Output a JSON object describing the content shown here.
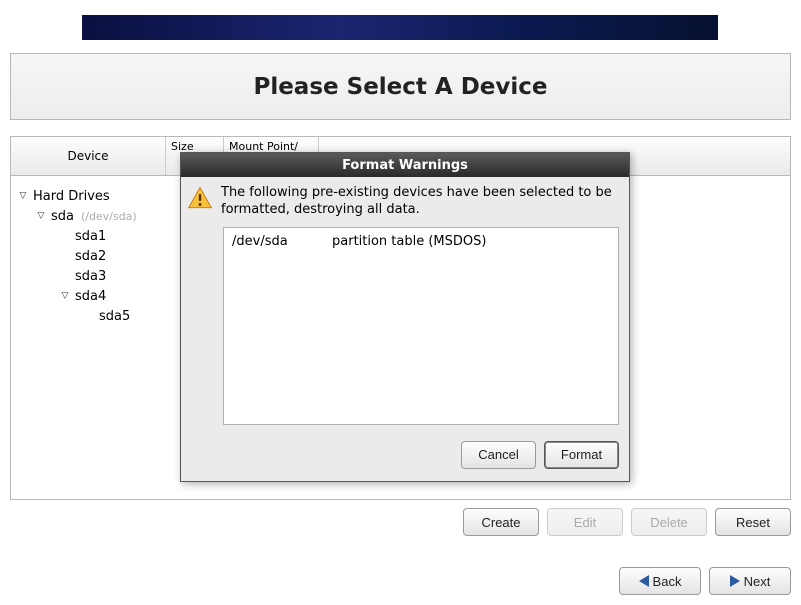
{
  "header": {
    "title": "Please Select A Device"
  },
  "columns": {
    "device": "Device",
    "size": "Size",
    "mount": "Mount Point/"
  },
  "tree": {
    "root_label": "Hard Drives",
    "sda_label": "sda",
    "sda_path": "(/dev/sda)",
    "sda1": "sda1",
    "sda2": "sda2",
    "sda3": "sda3",
    "sda4": "sda4",
    "sda5": "sda5"
  },
  "buttons": {
    "create": "Create",
    "edit": "Edit",
    "delete": "Delete",
    "reset": "Reset",
    "back": "Back",
    "next": "Next"
  },
  "dialog": {
    "title": "Format Warnings",
    "message": "The following pre-existing devices have been selected to be formatted, destroying all data.",
    "rows": [
      {
        "device": "/dev/sda",
        "desc": "partition table (MSDOS)"
      }
    ],
    "cancel": "Cancel",
    "format": "Format"
  }
}
